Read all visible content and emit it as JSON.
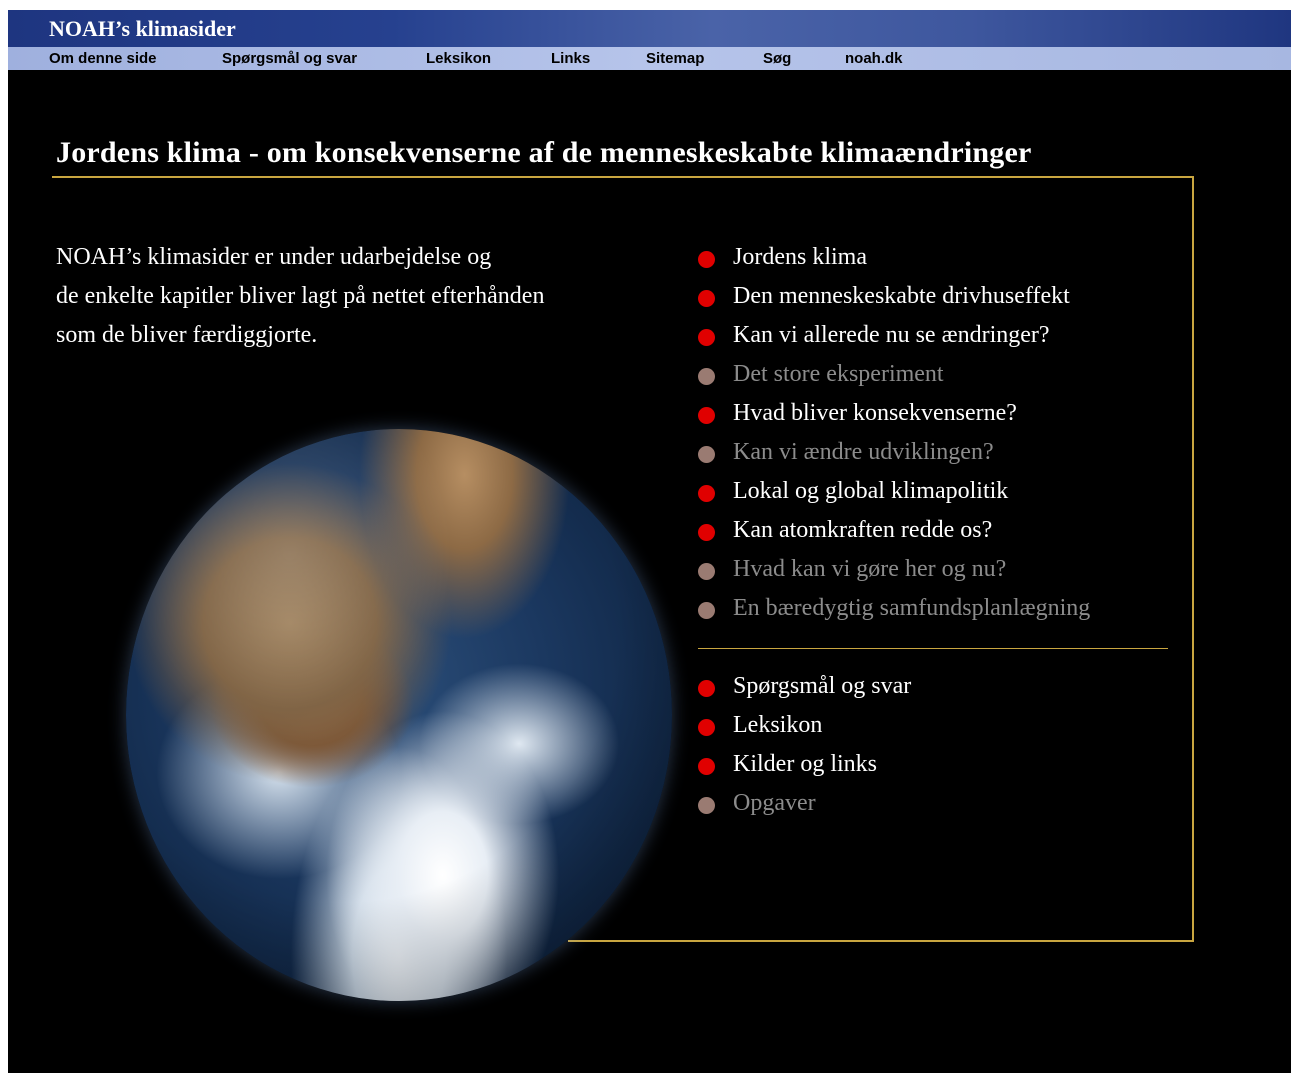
{
  "site": {
    "title": "NOAH’s klimasider"
  },
  "nav": {
    "items": [
      {
        "label": "Om denne side"
      },
      {
        "label": "Spørgsmål og svar"
      },
      {
        "label": "Leksikon"
      },
      {
        "label": "Links"
      },
      {
        "label": "Sitemap"
      },
      {
        "label": "Søg"
      },
      {
        "label": "noah.dk"
      }
    ]
  },
  "main": {
    "heading": "Jordens klima - om konsekvenserne af de menneskeskabte klimaændringer",
    "intro_lines": [
      "NOAH’s klimasider er under udarbejdelse og",
      "de enkelte kapitler bliver lagt på nettet efterhånden",
      "som de bliver færdiggjorte."
    ]
  },
  "chapters": [
    {
      "label": "Jordens klima",
      "status": "active"
    },
    {
      "label": "Den menneskeskabte drivhuseffekt",
      "status": "active"
    },
    {
      "label": "Kan vi allerede nu se ændringer?",
      "status": "active"
    },
    {
      "label": "Det store eksperiment",
      "status": "inactive"
    },
    {
      "label": "Hvad bliver konsekvenserne?",
      "status": "active"
    },
    {
      "label": "Kan vi ændre udviklingen?",
      "status": "inactive"
    },
    {
      "label": "Lokal og global klimapolitik",
      "status": "active"
    },
    {
      "label": "Kan atomkraften redde os?",
      "status": "active"
    },
    {
      "label": "Hvad kan vi gøre her og nu?",
      "status": "inactive"
    },
    {
      "label": "En bæredygtig samfundsplanlægning",
      "status": "inactive"
    }
  ],
  "resources": [
    {
      "label": "Spørgsmål og svar",
      "status": "active"
    },
    {
      "label": "Leksikon",
      "status": "active"
    },
    {
      "label": "Kilder og links",
      "status": "active"
    },
    {
      "label": "Opgaver",
      "status": "inactive"
    }
  ],
  "colors": {
    "background": "#000000",
    "title_bar": "#26418f",
    "nav_bar": "#b6c4ea",
    "accent_rule": "#c9a640",
    "bullet_active": "#e00000",
    "bullet_inactive": "#9a7b72",
    "text_active": "#ffffff",
    "text_inactive": "#8c8c8c"
  }
}
